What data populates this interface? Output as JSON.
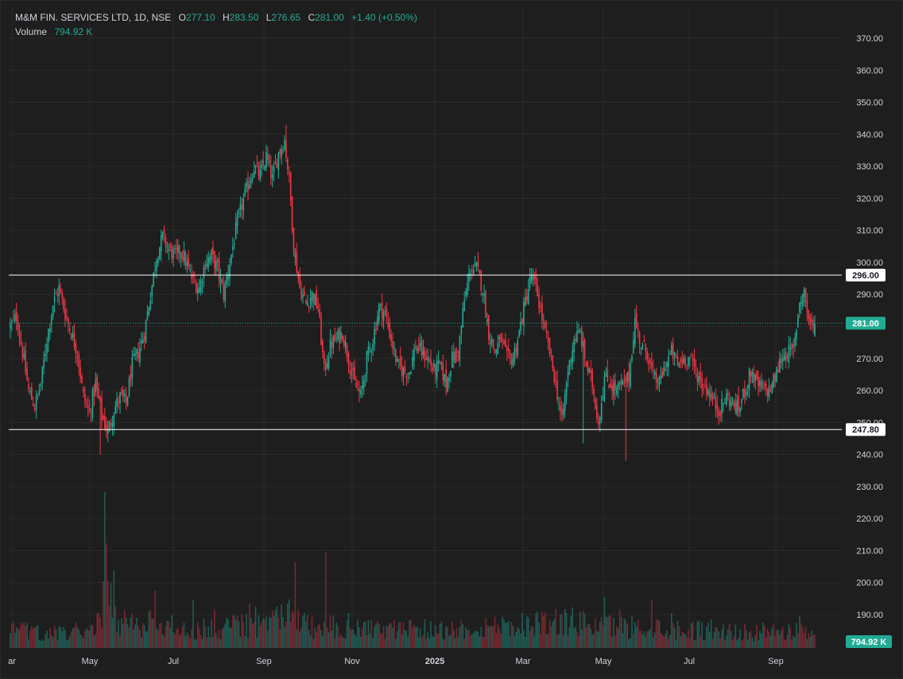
{
  "legend": {
    "symbol": "M&M FIN. SERVICES LTD, 1D, NSE",
    "o_label": "O",
    "o_value": "277.10",
    "h_label": "H",
    "h_value": "283.50",
    "l_label": "L",
    "l_value": "276.65",
    "c_label": "C",
    "c_value": "281.00",
    "change": "+1.40 (+0.50%)",
    "volume_label": "Volume",
    "volume_value": "794.92 K"
  },
  "colors": {
    "background": "#1e1e1e",
    "grid": "#2b2b2b",
    "up": "#22ab94",
    "down": "#f23645",
    "up_volume": "#1f5c54",
    "down_volume": "#7a2730",
    "axis_text": "#d1d4dc",
    "line": "#ffffff"
  },
  "chart_data": {
    "type": "candlestick",
    "price_axis": {
      "ticks": [
        "370.00",
        "360.00",
        "350.00",
        "340.00",
        "330.00",
        "320.00",
        "310.00",
        "300.00",
        "290.00",
        "280.00",
        "270.00",
        "260.00",
        "250.00",
        "240.00",
        "230.00",
        "220.00",
        "210.00",
        "200.00",
        "190.00"
      ],
      "ylim": [
        184,
        372
      ]
    },
    "time_axis": {
      "labels": [
        "ar",
        "May",
        "Jul",
        "Sep",
        "Nov",
        "2025",
        "Mar",
        "May",
        "Jul",
        "Sep"
      ],
      "bold": [
        "2025"
      ]
    },
    "horizontal_lines": [
      {
        "value": 296.0,
        "label": "296.00"
      },
      {
        "value": 247.8,
        "label": "247.80"
      }
    ],
    "last_price": {
      "value": 281.0,
      "label": "281.00"
    },
    "last_volume": {
      "label": "794.92 K"
    },
    "close_anchors": [
      [
        0,
        280
      ],
      [
        4,
        283
      ],
      [
        8,
        272
      ],
      [
        12,
        260
      ],
      [
        16,
        255
      ],
      [
        20,
        262
      ],
      [
        24,
        276
      ],
      [
        28,
        287
      ],
      [
        32,
        292
      ],
      [
        36,
        284
      ],
      [
        40,
        278
      ],
      [
        44,
        272
      ],
      [
        48,
        258
      ],
      [
        52,
        253
      ],
      [
        56,
        262
      ],
      [
        60,
        252
      ],
      [
        64,
        247
      ],
      [
        68,
        254
      ],
      [
        72,
        258
      ],
      [
        76,
        256
      ],
      [
        80,
        268
      ],
      [
        84,
        272
      ],
      [
        88,
        278
      ],
      [
        92,
        290
      ],
      [
        96,
        302
      ],
      [
        100,
        308
      ],
      [
        104,
        304
      ],
      [
        108,
        302
      ],
      [
        112,
        304
      ],
      [
        116,
        299
      ],
      [
        120,
        294
      ],
      [
        124,
        292
      ],
      [
        128,
        300
      ],
      [
        132,
        302
      ],
      [
        136,
        298
      ],
      [
        140,
        290
      ],
      [
        144,
        300
      ],
      [
        148,
        310
      ],
      [
        152,
        318
      ],
      [
        156,
        324
      ],
      [
        160,
        330
      ],
      [
        164,
        327
      ],
      [
        168,
        333
      ],
      [
        172,
        326
      ],
      [
        176,
        334
      ],
      [
        180,
        338
      ],
      [
        183,
        326
      ],
      [
        186,
        305
      ],
      [
        190,
        292
      ],
      [
        194,
        287
      ],
      [
        198,
        290
      ],
      [
        202,
        286
      ],
      [
        206,
        266
      ],
      [
        210,
        274
      ],
      [
        214,
        276
      ],
      [
        218,
        278
      ],
      [
        222,
        270
      ],
      [
        226,
        262
      ],
      [
        230,
        258
      ],
      [
        234,
        270
      ],
      [
        238,
        276
      ],
      [
        242,
        286
      ],
      [
        246,
        284
      ],
      [
        250,
        276
      ],
      [
        254,
        268
      ],
      [
        258,
        266
      ],
      [
        262,
        266
      ],
      [
        266,
        274
      ],
      [
        270,
        272
      ],
      [
        274,
        270
      ],
      [
        278,
        266
      ],
      [
        282,
        268
      ],
      [
        286,
        262
      ],
      [
        290,
        270
      ],
      [
        294,
        272
      ],
      [
        298,
        288
      ],
      [
        302,
        298
      ],
      [
        306,
        298
      ],
      [
        310,
        292
      ],
      [
        314,
        278
      ],
      [
        318,
        272
      ],
      [
        322,
        276
      ],
      [
        326,
        270
      ],
      [
        330,
        270
      ],
      [
        334,
        278
      ],
      [
        338,
        288
      ],
      [
        342,
        296
      ],
      [
        346,
        290
      ],
      [
        350,
        280
      ],
      [
        354,
        272
      ],
      [
        358,
        262
      ],
      [
        362,
        250
      ],
      [
        366,
        266
      ],
      [
        370,
        276
      ],
      [
        374,
        278
      ],
      [
        378,
        268
      ],
      [
        382,
        262
      ],
      [
        386,
        250
      ],
      [
        390,
        264
      ],
      [
        394,
        262
      ],
      [
        398,
        260
      ],
      [
        402,
        262
      ],
      [
        406,
        264
      ],
      [
        410,
        282
      ],
      [
        414,
        274
      ],
      [
        418,
        272
      ],
      [
        422,
        264
      ],
      [
        426,
        262
      ],
      [
        430,
        268
      ],
      [
        434,
        272
      ],
      [
        438,
        268
      ],
      [
        442,
        270
      ],
      [
        446,
        270
      ],
      [
        450,
        266
      ],
      [
        454,
        262
      ],
      [
        458,
        260
      ],
      [
        462,
        256
      ],
      [
        466,
        254
      ],
      [
        470,
        258
      ],
      [
        474,
        256
      ],
      [
        478,
        254
      ],
      [
        482,
        260
      ],
      [
        486,
        266
      ],
      [
        490,
        262
      ],
      [
        494,
        260
      ],
      [
        498,
        260
      ],
      [
        502,
        264
      ],
      [
        506,
        270
      ],
      [
        510,
        272
      ],
      [
        514,
        272
      ],
      [
        518,
        288
      ],
      [
        521,
        291
      ],
      [
        524,
        282
      ],
      [
        527,
        279
      ],
      [
        528,
        280
      ]
    ],
    "volume_anchors": [
      [
        0,
        0.6
      ],
      [
        20,
        0.5
      ],
      [
        40,
        0.5
      ],
      [
        60,
        0.9
      ],
      [
        63,
        4.2
      ],
      [
        70,
        0.9
      ],
      [
        90,
        0.8
      ],
      [
        110,
        0.7
      ],
      [
        130,
        0.6
      ],
      [
        150,
        0.8
      ],
      [
        170,
        0.7
      ],
      [
        180,
        1.2
      ],
      [
        200,
        0.6
      ],
      [
        210,
        0.7
      ],
      [
        230,
        0.6
      ],
      [
        260,
        0.6
      ],
      [
        290,
        0.6
      ],
      [
        310,
        0.7
      ],
      [
        340,
        0.8
      ],
      [
        360,
        0.9
      ],
      [
        380,
        0.8
      ],
      [
        400,
        0.7
      ],
      [
        420,
        0.7
      ],
      [
        440,
        0.6
      ],
      [
        460,
        0.6
      ],
      [
        480,
        0.5
      ],
      [
        500,
        0.5
      ],
      [
        520,
        0.6
      ],
      [
        528,
        0.4
      ]
    ],
    "volume_spikes": [
      [
        62,
        4.9
      ],
      [
        95,
        1.8
      ],
      [
        120,
        1.5
      ],
      [
        134,
        1.2
      ],
      [
        157,
        1.4
      ],
      [
        161,
        1.3
      ],
      [
        187,
        2.7
      ],
      [
        189,
        1.2
      ],
      [
        207,
        3.0
      ],
      [
        222,
        1.1
      ],
      [
        272,
        0.9
      ],
      [
        325,
        0.8
      ],
      [
        350,
        1.0
      ],
      [
        357,
        0.9
      ],
      [
        390,
        1.6
      ],
      [
        400,
        1.2
      ],
      [
        421,
        1.5
      ],
      [
        434,
        1.1
      ],
      [
        460,
        0.9
      ],
      [
        494,
        0.8
      ],
      [
        518,
        1.0
      ]
    ]
  }
}
